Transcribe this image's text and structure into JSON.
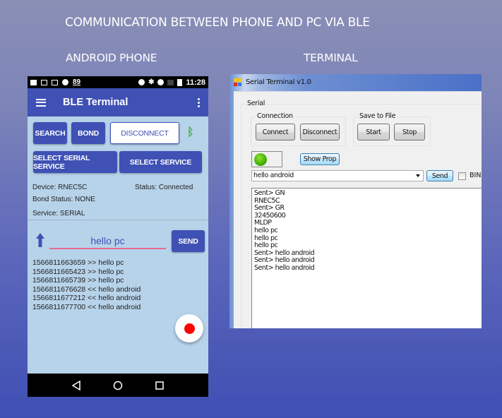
{
  "header": {
    "title": "COMMUNICATION BETWEEN PHONE AND PC VIA BLE",
    "android_label": "ANDROID PHONE",
    "terminal_label": "TERMINAL"
  },
  "phone": {
    "status_bar": {
      "left_icons": [
        "video-icon",
        "image-icon",
        "alert-icon",
        "android-icon"
      ],
      "notification_count": "89",
      "right_icons": [
        "location-icon",
        "bluetooth-icon",
        "do-not-disturb-icon",
        "no-signal-icon",
        "battery-charging-icon"
      ],
      "time": "11:28"
    },
    "app_bar": {
      "title": "BLE Terminal"
    },
    "buttons": {
      "search": "SEARCH",
      "bond": "BOND",
      "disconnect": "DISCONNECT",
      "select_serial_service": "SELECT SERIAL SERVICE",
      "select_service": "SELECT SERVICE",
      "send": "SEND"
    },
    "info": {
      "device": "Device: RNEC5C",
      "status": "Status: Connected",
      "bond_status": "Bond Status: NONE",
      "service": "Service: SERIAL"
    },
    "message_input": {
      "value": "hello pc"
    },
    "log": [
      "1566811663659 >> hello pc",
      "1566811665423 >> hello pc",
      "1566811665739 >> hello pc",
      "1566811676628 << hello android",
      "1566811677212 << hello android",
      "1566811677700 << hello android"
    ],
    "colors": {
      "primary": "#3f51b5",
      "background": "#b7d3ea",
      "accent": "#e76a93",
      "bluetooth": "#4caf50",
      "record": "#ff0000"
    }
  },
  "terminal": {
    "window_title": "Serial Terminal v1.0",
    "serial_group": "Serial",
    "connection_group": "Connection",
    "connect": "Connect",
    "disconnect": "Disconnect",
    "save_group": "Save to File",
    "start": "Start",
    "stop": "Stop",
    "show_prop": "Show Prop",
    "status_led": "green",
    "send_combo_value": "hello android",
    "send": "Send",
    "bin_label": "BIN",
    "bin_checked": false,
    "log": [
      "Sent> GN",
      "RNEC5C",
      "Sent> GR",
      "32450600",
      "MLDP",
      "hello pc",
      "hello pc",
      "hello pc",
      "Sent> hello android",
      "Sent> hello android",
      "Sent> hello android"
    ]
  }
}
